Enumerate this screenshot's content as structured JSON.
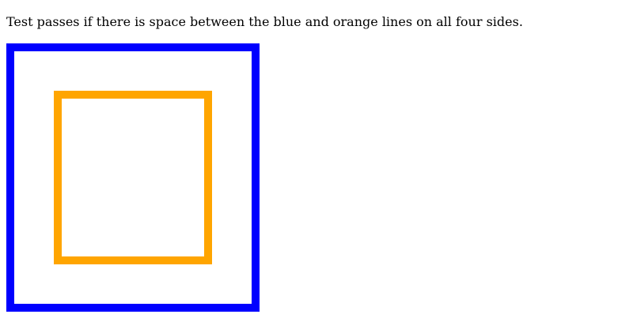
{
  "instruction": "Test passes if there is space between the blue and orange lines on all four sides.",
  "colors": {
    "outer_border": "#0000ff",
    "inner_border": "#ffa500",
    "background": "#ffffff",
    "text": "#000000"
  }
}
